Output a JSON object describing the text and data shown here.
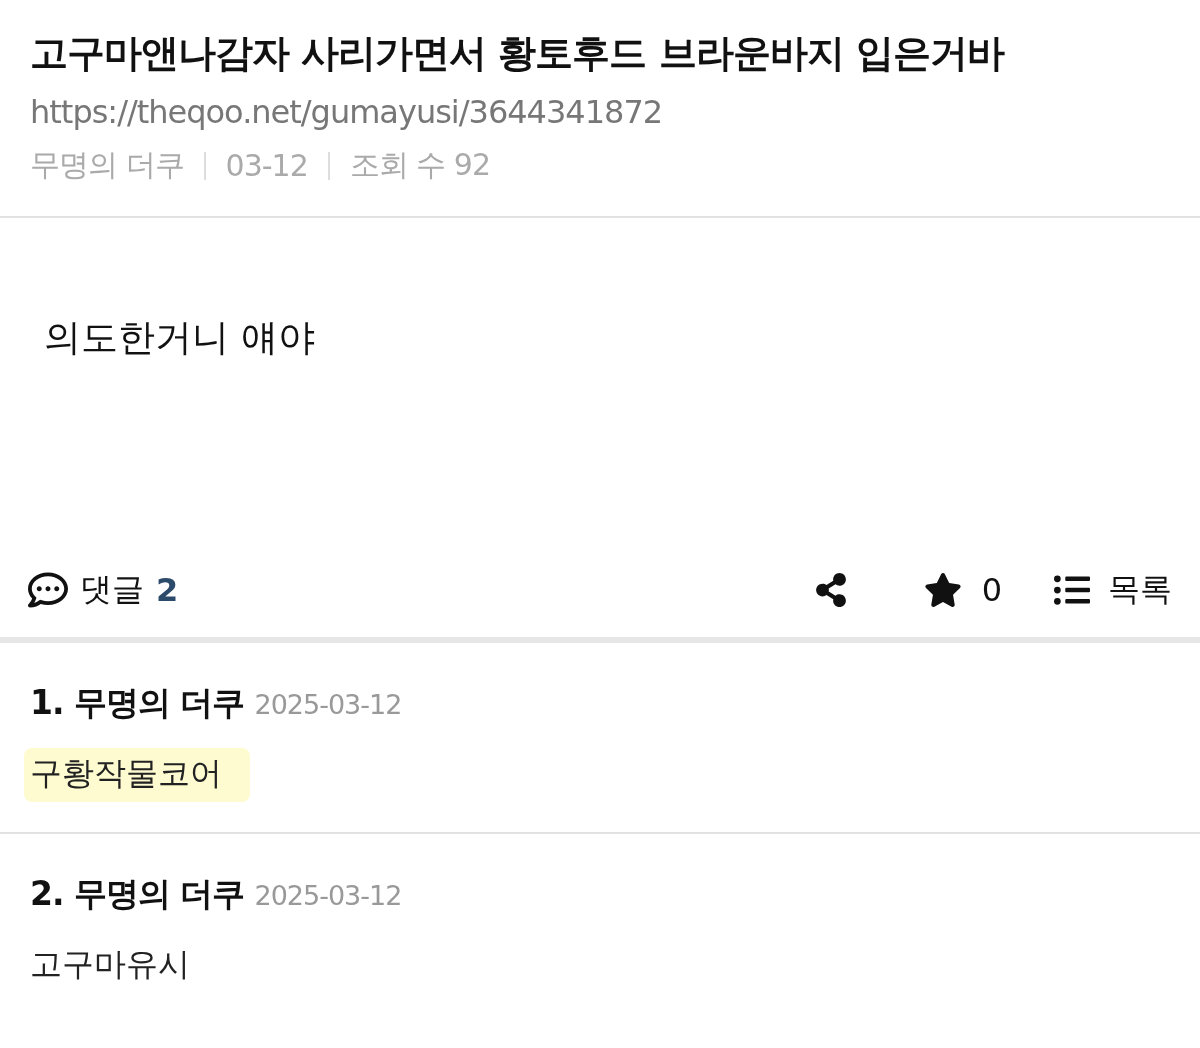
{
  "post": {
    "title": "고구마앤나감자 사리가면서 황토후드 브라운바지 입은거바",
    "url": "https://theqoo.net/gumayusi/3644341872",
    "author": "무명의 더쿠",
    "date": "03-12",
    "views": "조회 수 92",
    "body": "의도한거니 얘야"
  },
  "actions": {
    "comments_label": "댓글",
    "comments_count": "2",
    "likes": "0",
    "list_label": "목록"
  },
  "comments": [
    {
      "number": "1.",
      "author": "무명의 더쿠",
      "date": "2025-03-12",
      "text": "구황작물코어",
      "highlighted": true
    },
    {
      "number": "2.",
      "author": "무명의 더쿠",
      "date": "2025-03-12",
      "text": "고구마유시",
      "highlighted": false
    }
  ]
}
